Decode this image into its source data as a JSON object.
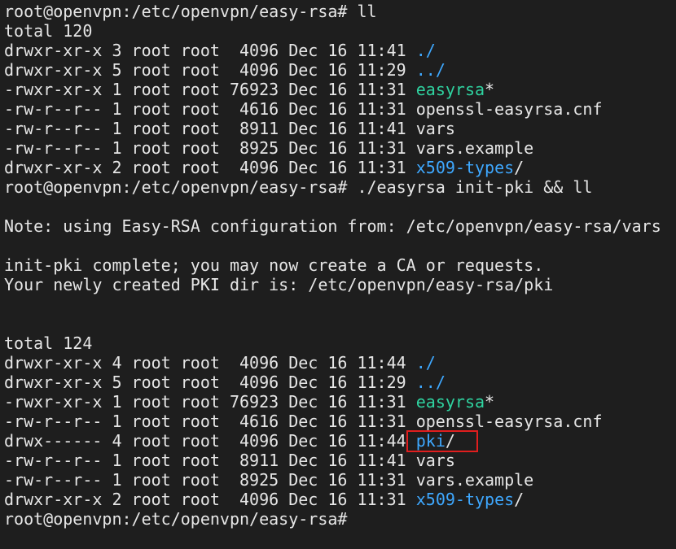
{
  "colors": {
    "background": "#1e1e1e",
    "default": "#e6e6e6",
    "dir": "#3ea8ff",
    "exec": "#2fd3a0",
    "highlight_border": "#e01e1e"
  },
  "terminal": {
    "lines": [
      {
        "segs": [
          {
            "t": "root@openvpn:/etc/openvpn/easy-rsa# ll",
            "c": "default"
          }
        ]
      },
      {
        "segs": [
          {
            "t": "total 120",
            "c": "default"
          }
        ]
      },
      {
        "segs": [
          {
            "t": "drwxr-xr-x 3 root root  4096 Dec 16 11:41 ",
            "c": "default"
          },
          {
            "t": "./",
            "c": "dir"
          }
        ]
      },
      {
        "segs": [
          {
            "t": "drwxr-xr-x 5 root root  4096 Dec 16 11:29 ",
            "c": "default"
          },
          {
            "t": "../",
            "c": "dir"
          }
        ]
      },
      {
        "segs": [
          {
            "t": "-rwxr-xr-x 1 root root 76923 Dec 16 11:31 ",
            "c": "default"
          },
          {
            "t": "easyrsa",
            "c": "exec"
          },
          {
            "t": "*",
            "c": "default"
          }
        ]
      },
      {
        "segs": [
          {
            "t": "-rw-r--r-- 1 root root  4616 Dec 16 11:31 openssl-easyrsa.cnf",
            "c": "default"
          }
        ]
      },
      {
        "segs": [
          {
            "t": "-rw-r--r-- 1 root root  8911 Dec 16 11:41 vars",
            "c": "default"
          }
        ]
      },
      {
        "segs": [
          {
            "t": "-rw-r--r-- 1 root root  8925 Dec 16 11:31 vars.example",
            "c": "default"
          }
        ]
      },
      {
        "segs": [
          {
            "t": "drwxr-xr-x 2 root root  4096 Dec 16 11:31 ",
            "c": "default"
          },
          {
            "t": "x509-types",
            "c": "dir"
          },
          {
            "t": "/",
            "c": "default"
          }
        ]
      },
      {
        "segs": [
          {
            "t": "root@openvpn:/etc/openvpn/easy-rsa# ./easyrsa init-pki && ll",
            "c": "default"
          }
        ]
      },
      {
        "segs": [
          {
            "t": "",
            "c": "default"
          }
        ]
      },
      {
        "segs": [
          {
            "t": "Note: using Easy-RSA configuration from: /etc/openvpn/easy-rsa/vars",
            "c": "default"
          }
        ]
      },
      {
        "segs": [
          {
            "t": "",
            "c": "default"
          }
        ]
      },
      {
        "segs": [
          {
            "t": "init-pki complete; you may now create a CA or requests.",
            "c": "default"
          }
        ]
      },
      {
        "segs": [
          {
            "t": "Your newly created PKI dir is: /etc/openvpn/easy-rsa/pki",
            "c": "default"
          }
        ]
      },
      {
        "segs": [
          {
            "t": "",
            "c": "default"
          }
        ]
      },
      {
        "segs": [
          {
            "t": "",
            "c": "default"
          }
        ]
      },
      {
        "segs": [
          {
            "t": "total 124",
            "c": "default"
          }
        ]
      },
      {
        "segs": [
          {
            "t": "drwxr-xr-x 4 root root  4096 Dec 16 11:44 ",
            "c": "default"
          },
          {
            "t": "./",
            "c": "dir"
          }
        ]
      },
      {
        "segs": [
          {
            "t": "drwxr-xr-x 5 root root  4096 Dec 16 11:29 ",
            "c": "default"
          },
          {
            "t": "../",
            "c": "dir"
          }
        ]
      },
      {
        "segs": [
          {
            "t": "-rwxr-xr-x 1 root root 76923 Dec 16 11:31 ",
            "c": "default"
          },
          {
            "t": "easyrsa",
            "c": "exec"
          },
          {
            "t": "*",
            "c": "default"
          }
        ]
      },
      {
        "segs": [
          {
            "t": "-rw-r--r-- 1 root root  4616 Dec 16 11:31 openssl-easyrsa.cnf",
            "c": "default"
          }
        ]
      },
      {
        "segs": [
          {
            "t": "drwx------ 4 root root  4096 Dec 16 11:44 ",
            "c": "default"
          },
          {
            "t": "pki",
            "c": "dir"
          },
          {
            "t": "/",
            "c": "default"
          }
        ]
      },
      {
        "segs": [
          {
            "t": "-rw-r--r-- 1 root root  8911 Dec 16 11:41 vars",
            "c": "default"
          }
        ]
      },
      {
        "segs": [
          {
            "t": "-rw-r--r-- 1 root root  8925 Dec 16 11:31 vars.example",
            "c": "default"
          }
        ]
      },
      {
        "segs": [
          {
            "t": "drwxr-xr-x 2 root root  4096 Dec 16 11:31 ",
            "c": "default"
          },
          {
            "t": "x509-types",
            "c": "dir"
          },
          {
            "t": "/",
            "c": "default"
          }
        ]
      },
      {
        "segs": [
          {
            "t": "root@openvpn:/etc/openvpn/easy-rsa#",
            "c": "default"
          }
        ]
      }
    ]
  }
}
